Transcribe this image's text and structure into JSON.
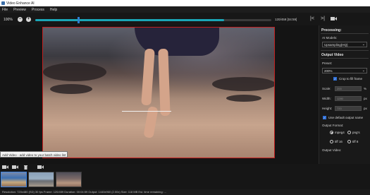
{
  "window": {
    "title": "Video Enhance AI"
  },
  "menu": {
    "file": "File",
    "preview": "Preview",
    "process": "Process",
    "help": "Help"
  },
  "toolbar": {
    "zoom": "100%",
    "minus": "−",
    "plus": "+",
    "timecode": "120/459 [04:59]",
    "progress": 0.8,
    "marker": 0.18
  },
  "preview": {
    "tooltip": "Add Video - add video to your batch video list"
  },
  "panel": {
    "processing_title": "Processing:",
    "ai_models_label": "AI Models:",
    "ai_model_value": "Upsampling(HQ)",
    "output_title": "Output Video",
    "preset_label": "Preset:",
    "preset_value": "200%",
    "crop_label": "Crop to fill frame",
    "crop_checked": true,
    "scale_label": "Scale:",
    "scale_value": "200",
    "scale_unit": "%",
    "width_label": "Width:",
    "width_value": "1280",
    "width_unit": "px",
    "height_label": "Height:",
    "height_value": "720",
    "height_unit": "px",
    "default_name_label": "Use default output name",
    "default_name_checked": true,
    "format_label": "Output Format:",
    "format_options": [
      "mpeg4",
      "png's",
      "tiff 16",
      "tiff 8"
    ],
    "format_selected": "mpeg4",
    "output_video_label": "Output Video:"
  },
  "bottom": {
    "status": "Resolution: 720x480 (SD) 30 fps  Frame: 120/459  Duration: 00:04:59  Output: 1440x960 (2.00x)  Size: 118 MB  Est. time remaining: ..."
  },
  "colors": {
    "accent": "#2f6fd6",
    "timeline": "#1aa6b7",
    "frame_border": "#c21f1f"
  }
}
